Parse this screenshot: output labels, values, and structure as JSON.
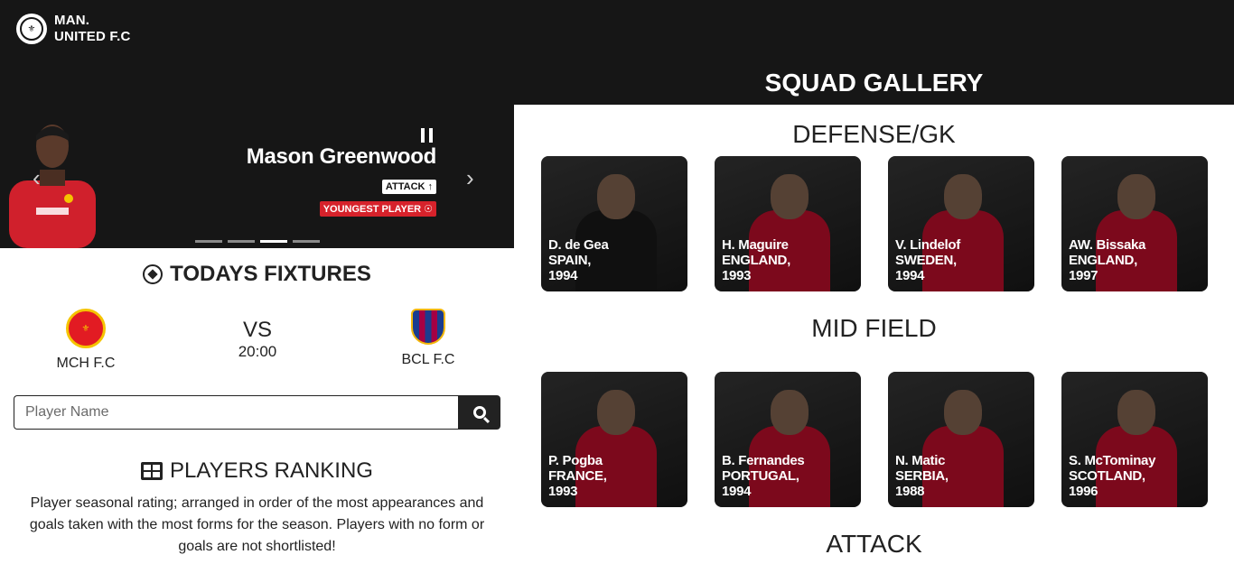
{
  "brand": {
    "line1": "MAN.",
    "line2": "UNITED F.C"
  },
  "hero": {
    "player_name": "Mason Greenwood",
    "position_badge": "ATTACK",
    "highlight_badge": "YOUNGEST PLAYER",
    "slides_count": 4,
    "active_slide": 3
  },
  "fixtures": {
    "title": "TODAYS FIXTURES",
    "home": "MCH F.C",
    "vs": "VS",
    "time": "20:00",
    "away": "BCL F.C"
  },
  "search": {
    "placeholder": "Player Name"
  },
  "ranking": {
    "title": "PLAYERS RANKING",
    "description": "Player seasonal rating; arranged in order of the most appearances and goals taken with the most forms for the season. Players with no form or goals are not shortlisted!"
  },
  "gallery": {
    "title": "SQUAD GALLERY",
    "sections": [
      {
        "title": "DEFENSE/GK",
        "players": [
          {
            "name": "D. de Gea",
            "country": "SPAIN,",
            "year": "1994",
            "kit": "#1b1b1b"
          },
          {
            "name": "H. Maguire",
            "country": "ENGLAND,",
            "year": "1993",
            "kit": "#c8102e"
          },
          {
            "name": "V. Lindelof",
            "country": "SWEDEN,",
            "year": "1994",
            "kit": "#c8102e"
          },
          {
            "name": "AW. Bissaka",
            "country": "ENGLAND,",
            "year": "1997",
            "kit": "#c8102e"
          }
        ]
      },
      {
        "title": "MID FIELD",
        "players": [
          {
            "name": "P. Pogba",
            "country": "FRANCE,",
            "year": "1993",
            "kit": "#c8102e"
          },
          {
            "name": "B. Fernandes",
            "country": "PORTUGAL,",
            "year": "1994",
            "kit": "#c8102e"
          },
          {
            "name": "N. Matic",
            "country": "SERBIA,",
            "year": "1988",
            "kit": "#c8102e"
          },
          {
            "name": "S. McTominay",
            "country": "SCOTLAND,",
            "year": "1996",
            "kit": "#c8102e"
          }
        ]
      },
      {
        "title": "ATTACK",
        "players": []
      }
    ]
  }
}
